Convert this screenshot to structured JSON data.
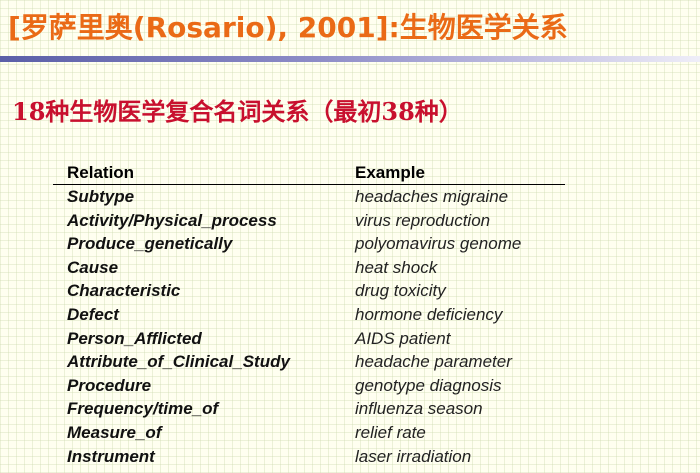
{
  "slide": {
    "title": "[罗萨里奥(Rosario), 2001]:生物医学关系",
    "subtitle": "18种生物医学复合名词关系（最初38种）"
  },
  "table": {
    "headers": {
      "relation": "Relation",
      "example": "Example"
    },
    "rows": [
      {
        "relation": "Subtype",
        "example": "headaches migraine"
      },
      {
        "relation": "Activity/Physical_process",
        "example": "virus reproduction"
      },
      {
        "relation": "Produce_genetically",
        "example": "polyomavirus genome"
      },
      {
        "relation": "Cause",
        "example": "heat shock"
      },
      {
        "relation": "Characteristic",
        "example": "drug toxicity"
      },
      {
        "relation": "Defect",
        "example": "hormone deficiency"
      },
      {
        "relation": "Person_Afflicted",
        "example": "AIDS patient"
      },
      {
        "relation": "Attribute_of_Clinical_Study",
        "example": "headache parameter"
      },
      {
        "relation": "Procedure",
        "example": "genotype diagnosis"
      },
      {
        "relation": "Frequency/time_of",
        "example": "influenza season"
      },
      {
        "relation": "Measure_of",
        "example": "relief rate"
      },
      {
        "relation": "Instrument",
        "example": "laser irradiation"
      }
    ]
  },
  "colors": {
    "title": "#ea6a16",
    "subtitle": "#c8102e",
    "rule": "#5b5fa8",
    "background": "#fffff0"
  }
}
